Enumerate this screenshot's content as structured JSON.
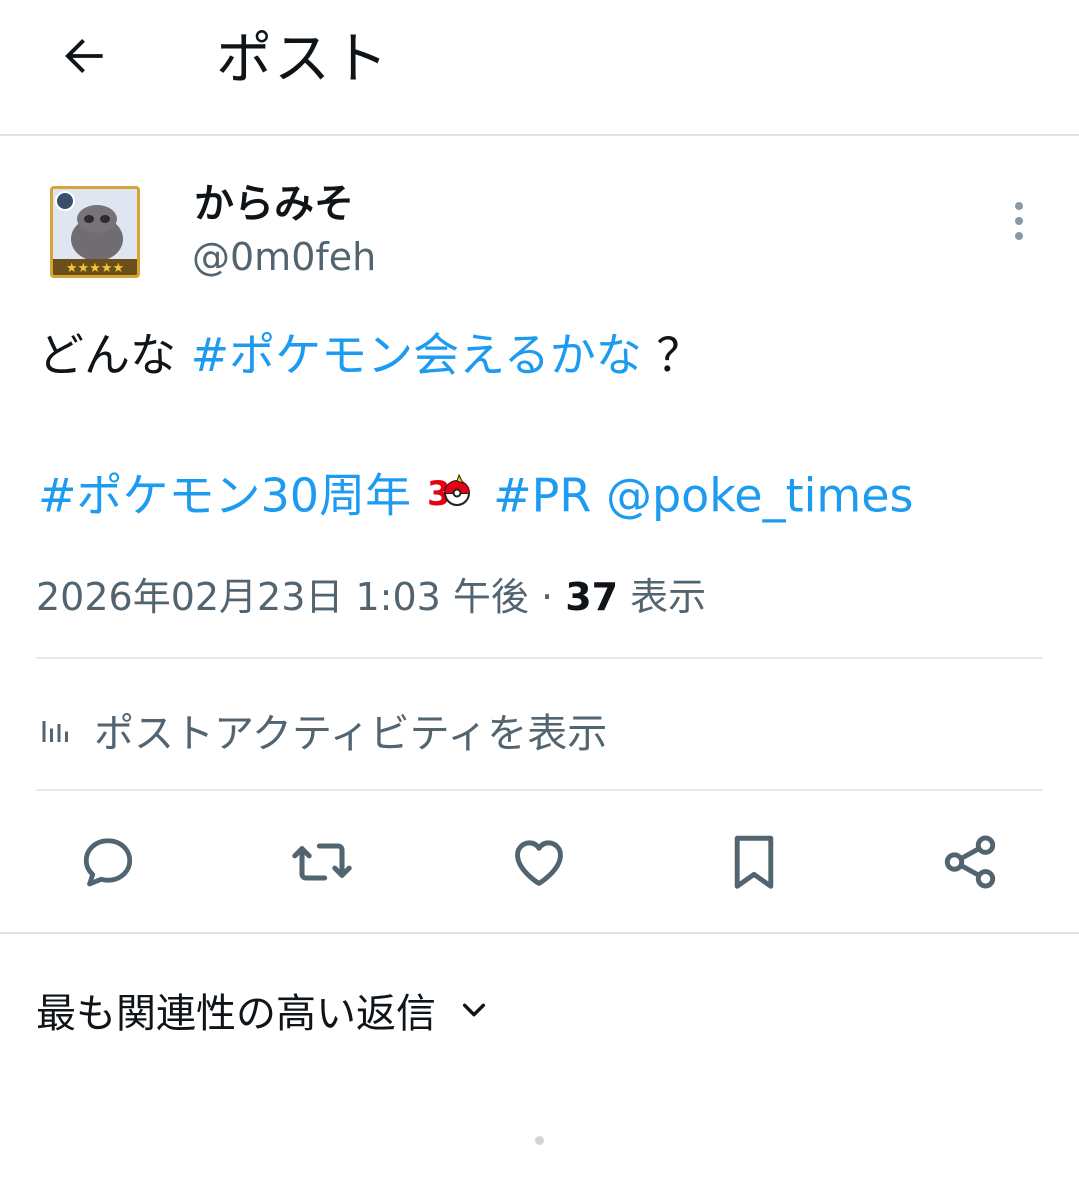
{
  "header": {
    "title": "ポスト",
    "back_icon": "arrow-left-icon"
  },
  "author": {
    "display_name": "からみそ",
    "handle": "@0m0feh"
  },
  "post": {
    "text_prefix": "どんな ",
    "hashtag_1": "#ポケモン会えるかな",
    "text_suffix": "？",
    "hashtag_2": "#ポケモン30周年",
    "emoji_icon": "pokemon-30th-emoji",
    "hashtag_3": "#PR",
    "mention": "@poke_times"
  },
  "meta": {
    "timestamp": "2026年02月23日 1:03 午後",
    "separator": "·",
    "views_count": "37",
    "views_label": "表示"
  },
  "activity": {
    "label": "ポストアクティビティを表示",
    "icon": "bar-chart-icon"
  },
  "actions": {
    "icons": [
      "reply-icon",
      "repost-icon",
      "like-icon",
      "bookmark-icon",
      "share-icon"
    ]
  },
  "replies": {
    "sort_label": "最も関連性の高い返信"
  },
  "colors": {
    "link": "#1d9bf0",
    "secondary_text": "#536471",
    "primary_text": "#0f1419",
    "divider": "#d9e3e8"
  }
}
